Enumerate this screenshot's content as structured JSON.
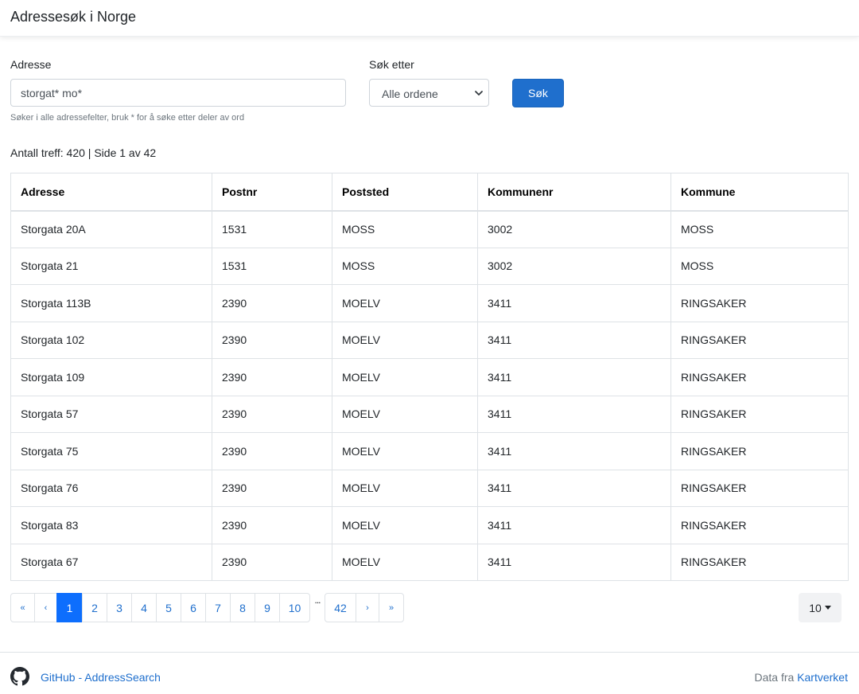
{
  "app": {
    "title": "Adressesøk i Norge"
  },
  "search": {
    "address_label": "Adresse",
    "address_value": "storgat* mo*",
    "help_text": "Søker i alle adressefelter, bruk * for å søke etter deler av ord",
    "mode_label": "Søk etter",
    "mode_value": "Alle ordene",
    "button_label": "Søk"
  },
  "results": {
    "summary": "Antall treff: 420 | Side 1 av 42",
    "columns": [
      "Adresse",
      "Postnr",
      "Poststed",
      "Kommunenr",
      "Kommune"
    ],
    "rows": [
      [
        "Storgata 20A",
        "1531",
        "MOSS",
        "3002",
        "MOSS"
      ],
      [
        "Storgata 21",
        "1531",
        "MOSS",
        "3002",
        "MOSS"
      ],
      [
        "Storgata 113B",
        "2390",
        "MOELV",
        "3411",
        "RINGSAKER"
      ],
      [
        "Storgata 102",
        "2390",
        "MOELV",
        "3411",
        "RINGSAKER"
      ],
      [
        "Storgata 109",
        "2390",
        "MOELV",
        "3411",
        "RINGSAKER"
      ],
      [
        "Storgata 57",
        "2390",
        "MOELV",
        "3411",
        "RINGSAKER"
      ],
      [
        "Storgata 75",
        "2390",
        "MOELV",
        "3411",
        "RINGSAKER"
      ],
      [
        "Storgata 76",
        "2390",
        "MOELV",
        "3411",
        "RINGSAKER"
      ],
      [
        "Storgata 83",
        "2390",
        "MOELV",
        "3411",
        "RINGSAKER"
      ],
      [
        "Storgata 67",
        "2390",
        "MOELV",
        "3411",
        "RINGSAKER"
      ]
    ]
  },
  "pagination": {
    "first": "«",
    "prev": "‹",
    "pages": [
      "1",
      "2",
      "3",
      "4",
      "5",
      "6",
      "7",
      "8",
      "9",
      "10"
    ],
    "active_page": "1",
    "ellipsis": "...",
    "last_page": "42",
    "next": "›",
    "last": "»",
    "per_page": "10"
  },
  "footer": {
    "github_label": "GitHub - AddressSearch",
    "credit_prefix": "Data fra",
    "credit_link": "Kartverket"
  },
  "colors": {
    "primary": "#1f6fcd",
    "active_page": "#0d6efd"
  }
}
